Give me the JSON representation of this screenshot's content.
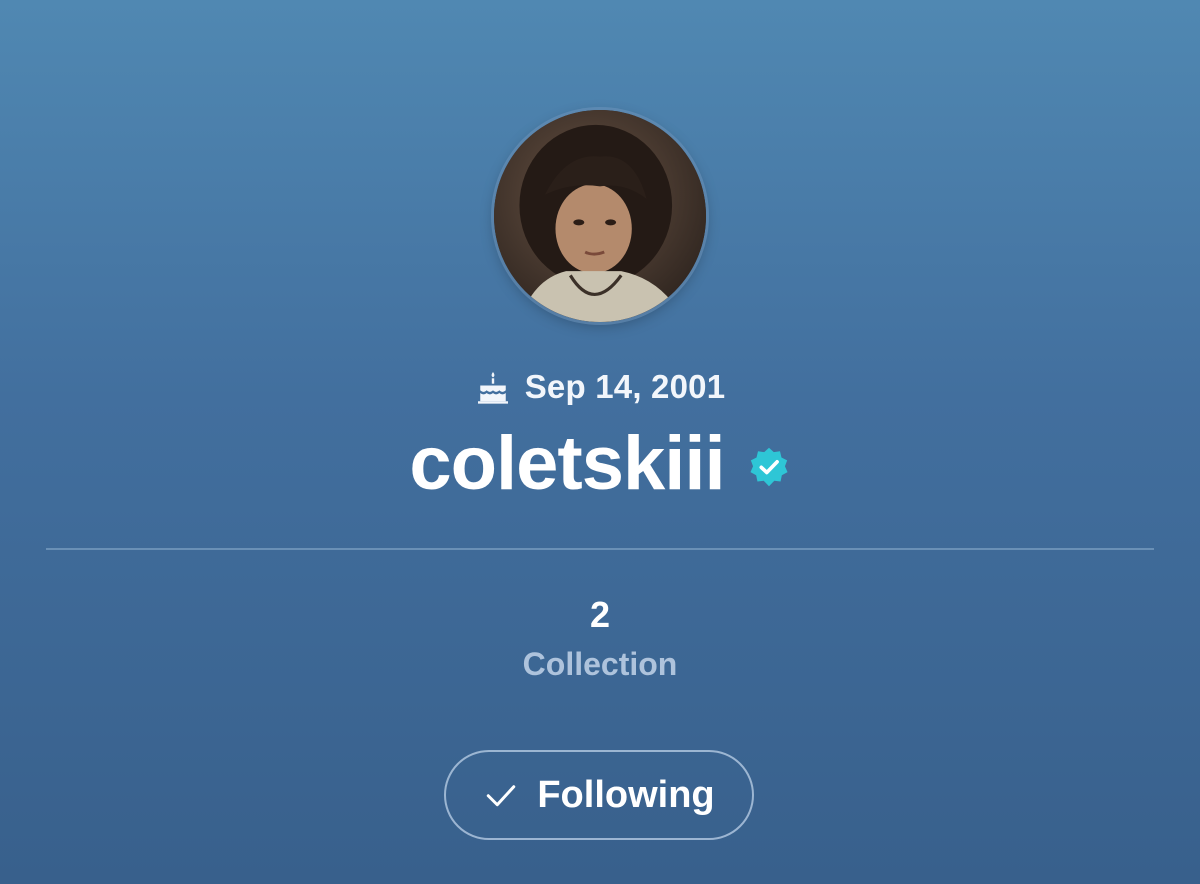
{
  "profile": {
    "birthday": "Sep 14, 2001",
    "username": "coletskiii",
    "verified": true,
    "avatar_icon": "profile-photo",
    "birthday_icon": "cake-icon"
  },
  "stats": {
    "collection_count": "2",
    "collection_label": "Collection"
  },
  "actions": {
    "follow_label": "Following",
    "follow_icon": "check-icon"
  },
  "colors": {
    "background_top": "#5088b2",
    "background_bottom": "#38608c",
    "verified_badge": "#2ec6d6",
    "label_muted": "#aec3dc"
  }
}
